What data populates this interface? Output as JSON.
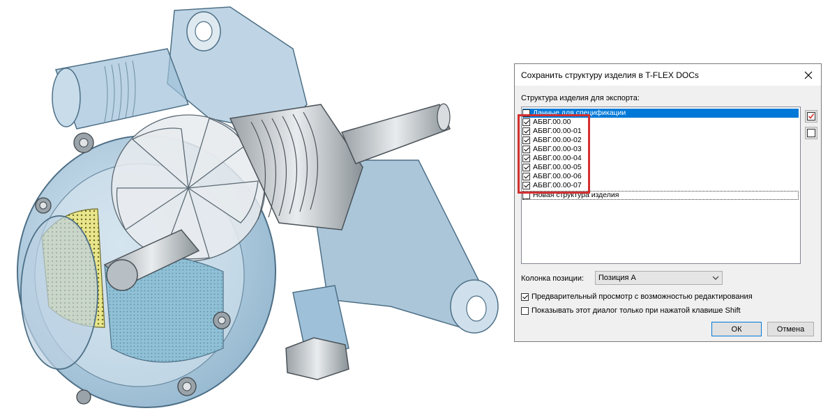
{
  "dialog": {
    "title": "Сохранить структуру изделия в T-FLEX DOCs",
    "close_icon": "close-icon",
    "section_label": "Структура изделия для экспорта:",
    "tree_items": [
      {
        "label": "Данные для спецификации",
        "checked": false,
        "selected": true
      },
      {
        "label": "АБВГ.00.00",
        "checked": true
      },
      {
        "label": "АБВГ.00.00-01",
        "checked": true
      },
      {
        "label": "АБВГ.00.00-02",
        "checked": true
      },
      {
        "label": "АБВГ.00.00-03",
        "checked": true
      },
      {
        "label": "АБВГ.00.00-04",
        "checked": true
      },
      {
        "label": "АБВГ.00.00-05",
        "checked": true
      },
      {
        "label": "АБВГ.00.00-06",
        "checked": true
      },
      {
        "label": "АБВГ.00.00-07",
        "checked": true
      },
      {
        "label": "Новая структура изделия",
        "checked": false,
        "focused": true
      }
    ],
    "side_buttons": [
      {
        "icon": "check-all-icon"
      },
      {
        "icon": "uncheck-all-icon"
      }
    ],
    "position_column": {
      "label": "Колонка позиции:",
      "value": "Позиция А"
    },
    "options": [
      {
        "label": "Предварительный просмотр с возможностью редактирования",
        "checked": true
      },
      {
        "label": "Показывать этот диалог только при нажатой клавише Shift",
        "checked": false
      }
    ],
    "ok_label": "ОК",
    "cancel_label": "Отмена"
  },
  "colors": {
    "accent": "#0078d7",
    "highlight": "#d32f2f",
    "part_blue": "#8fb8d4",
    "part_grey": "#c8cdd1"
  },
  "cad_model": {
    "icon": "pump-assembly-model"
  }
}
